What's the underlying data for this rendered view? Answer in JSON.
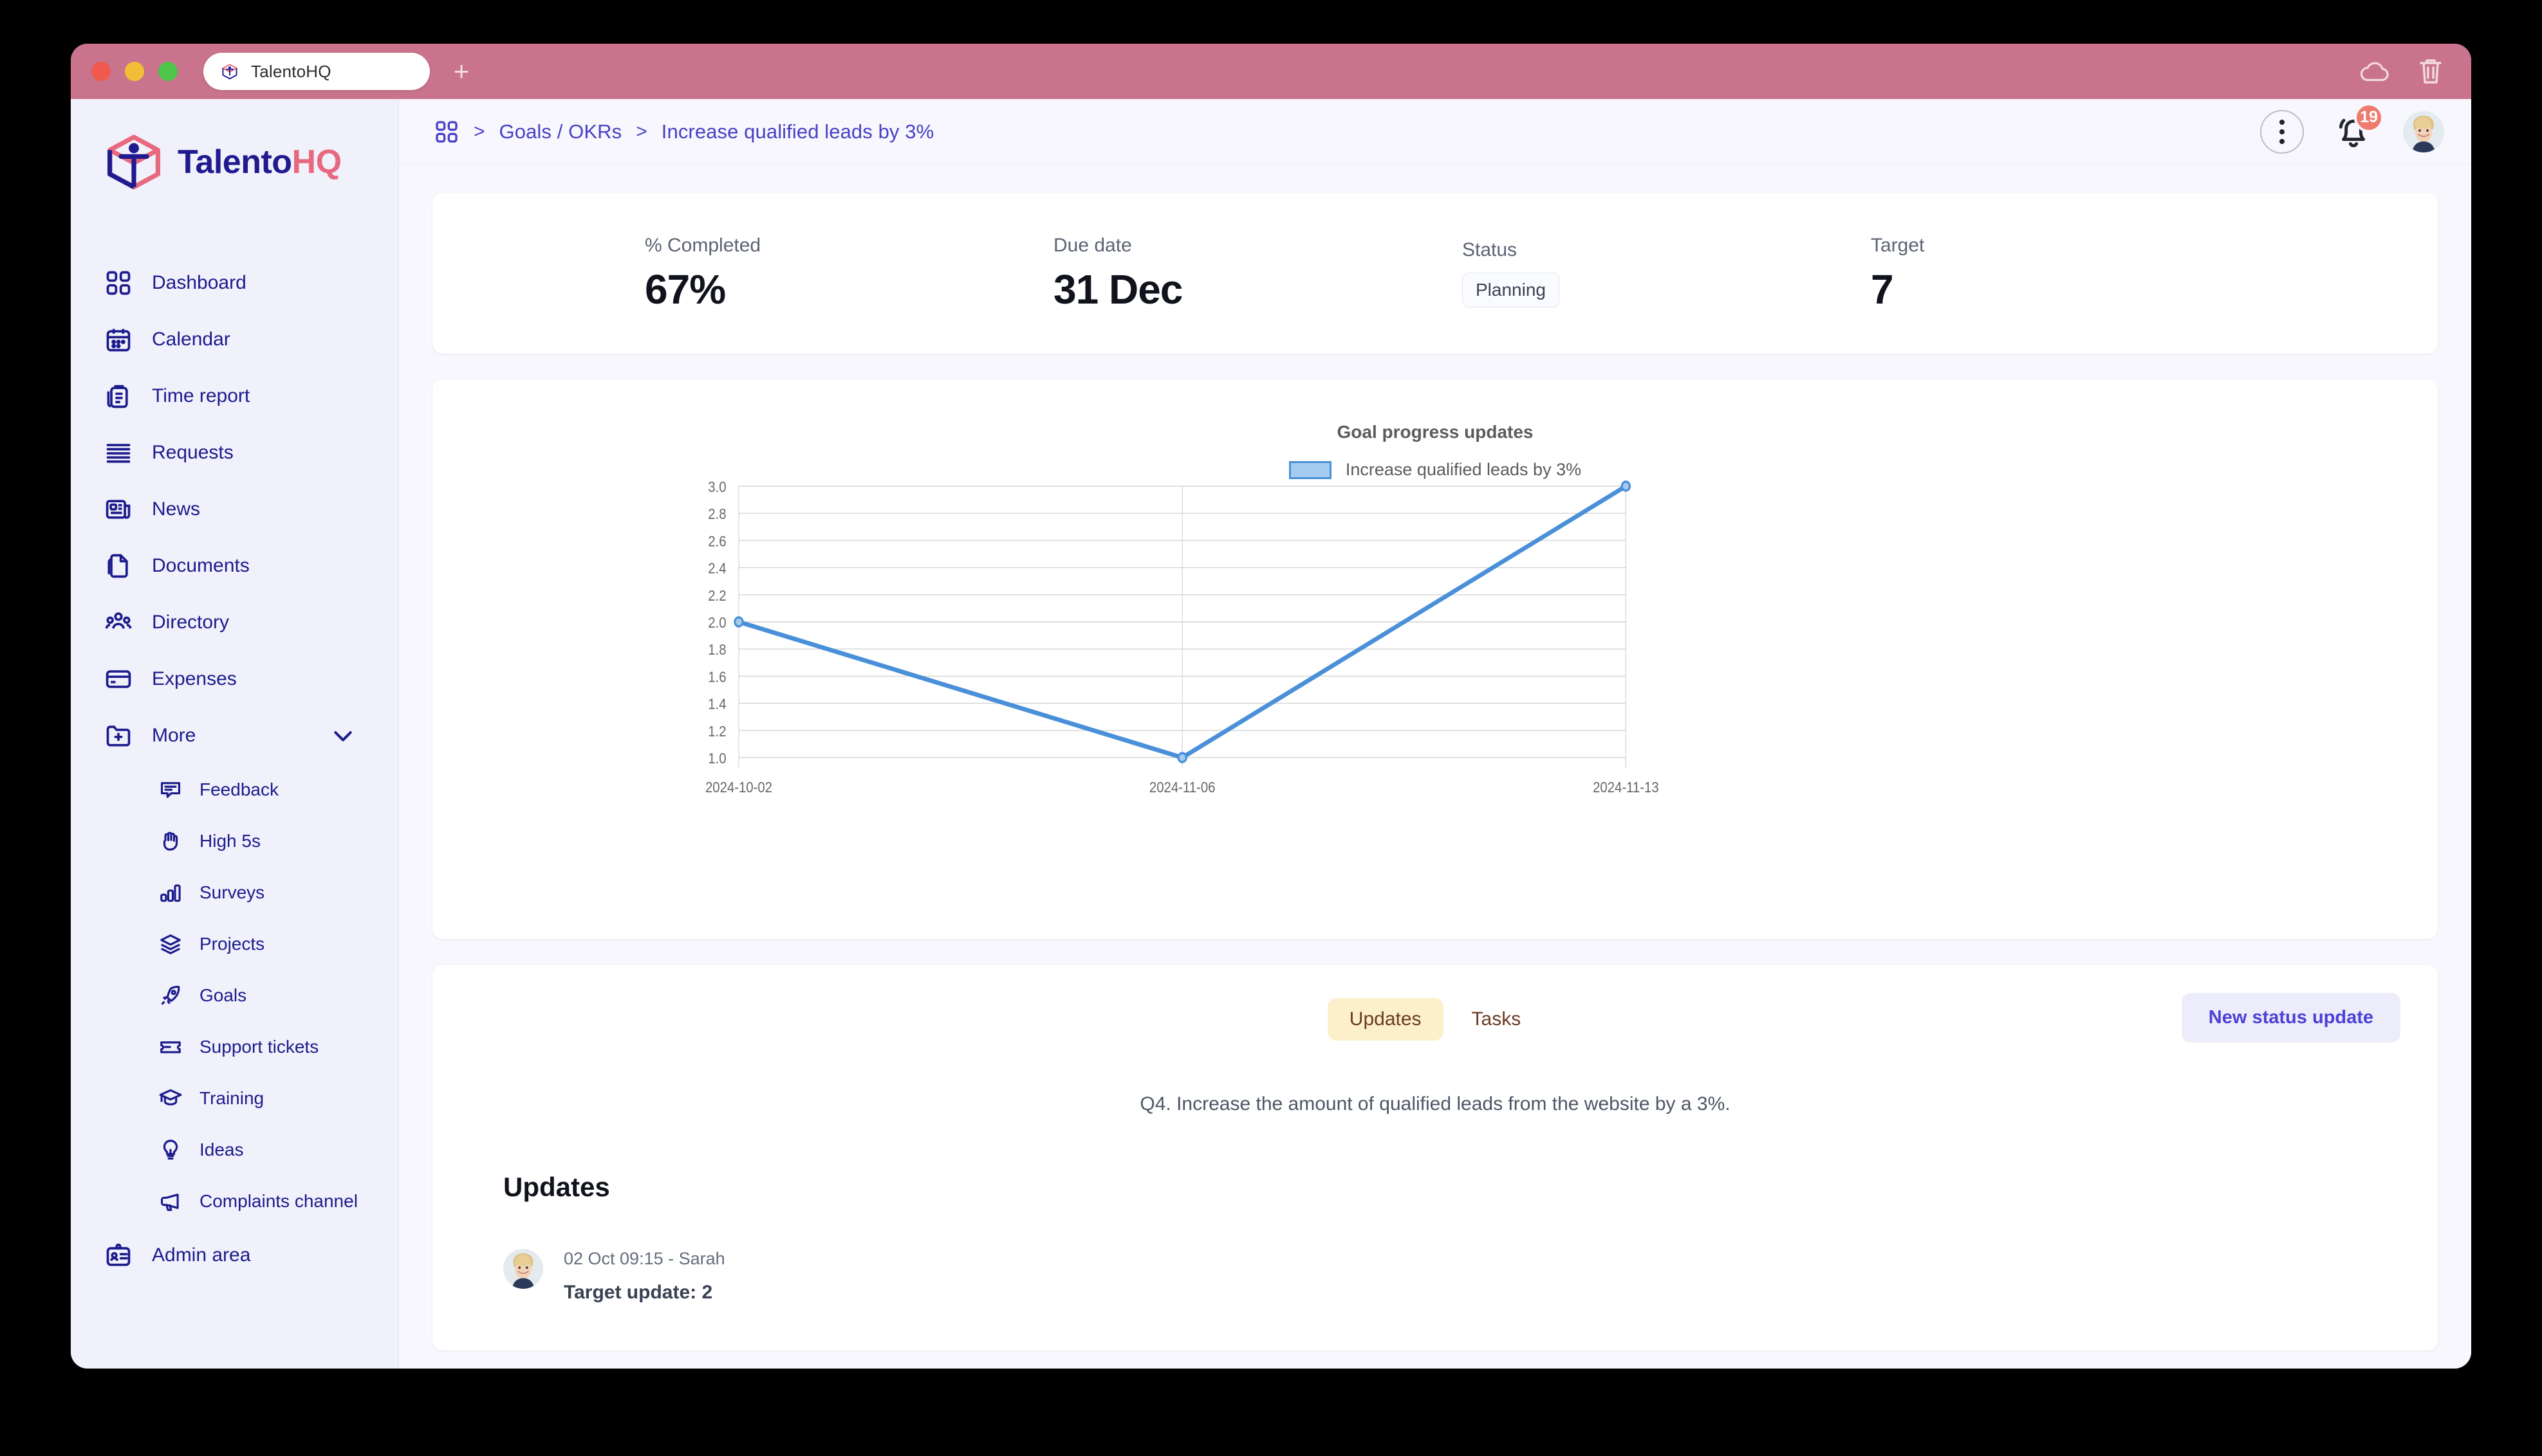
{
  "browser": {
    "tab_title": "TalentoHQ",
    "favicon_icon": "talentohq-cube-icon",
    "new_tab_icon": "plus-icon",
    "window_controls": [
      "close",
      "minimize",
      "maximize"
    ],
    "right_icons": [
      "cloud-icon",
      "trash-icon"
    ]
  },
  "sidebar": {
    "brand": {
      "name_primary": "Talento",
      "name_secondary": "HQ",
      "logo_icon": "talentohq-cube-logo"
    },
    "items": [
      {
        "label": "Dashboard",
        "icon": "grid-icon"
      },
      {
        "label": "Calendar",
        "icon": "calendar-icon"
      },
      {
        "label": "Time report",
        "icon": "clipboard-list-icon"
      },
      {
        "label": "Requests",
        "icon": "stacked-lines-icon"
      },
      {
        "label": "News",
        "icon": "newspaper-icon"
      },
      {
        "label": "Documents",
        "icon": "documents-icon"
      },
      {
        "label": "Directory",
        "icon": "people-group-icon"
      },
      {
        "label": "Expenses",
        "icon": "credit-card-icon"
      },
      {
        "label": "More",
        "icon": "folder-plus-icon",
        "expandable": true,
        "chevron_icon": "chevron-down-icon"
      }
    ],
    "sub_items": [
      {
        "label": "Feedback",
        "icon": "speech-bubble-icon"
      },
      {
        "label": "High 5s",
        "icon": "hand-icon"
      },
      {
        "label": "Surveys",
        "icon": "bar-chart-icon"
      },
      {
        "label": "Projects",
        "icon": "layers-icon"
      },
      {
        "label": "Goals",
        "icon": "rocket-icon"
      },
      {
        "label": "Support tickets",
        "icon": "ticket-icon"
      },
      {
        "label": "Training",
        "icon": "graduation-cap-icon"
      },
      {
        "label": "Ideas",
        "icon": "lightbulb-icon"
      },
      {
        "label": "Complaints channel",
        "icon": "megaphone-icon"
      }
    ],
    "footer_items": [
      {
        "label": "Admin area",
        "icon": "id-badge-icon"
      }
    ]
  },
  "topbar": {
    "home_icon": "grid-icon",
    "separator": ">",
    "breadcrumb": [
      "Goals / OKRs",
      "Increase qualified leads by 3%"
    ],
    "kebab_icon": "kebab-menu-icon",
    "bell_icon": "bell-icon",
    "notification_count": "19",
    "avatar_icon": "user-avatar"
  },
  "stats": [
    {
      "label": "% Completed",
      "value": "67%",
      "type": "text"
    },
    {
      "label": "Due date",
      "value": "31 Dec",
      "type": "text"
    },
    {
      "label": "Status",
      "value": "Planning",
      "type": "pill"
    },
    {
      "label": "Target",
      "value": "7",
      "type": "text"
    }
  ],
  "chart_data": {
    "type": "line",
    "title": "Goal progress updates",
    "xlabel": "",
    "ylabel": "",
    "x": [
      "2024-10-02",
      "2024-11-06",
      "2024-11-13"
    ],
    "series": [
      {
        "name": "Increase qualified leads by 3%",
        "values": [
          2.0,
          1.0,
          3.0
        ],
        "color": "#4a90d9",
        "fill": "#a5cbef"
      }
    ],
    "ylim": [
      1.0,
      3.0
    ],
    "yticks": [
      "1.0",
      "1.2",
      "1.4",
      "1.6",
      "1.8",
      "2.0",
      "2.2",
      "2.4",
      "2.6",
      "2.8",
      "3.0"
    ],
    "xticks": [
      "2024-10-02",
      "2024-11-06",
      "2024-11-13"
    ],
    "grid": true,
    "legend_position": "top"
  },
  "updates_panel": {
    "tabs": [
      {
        "label": "Updates",
        "active": true
      },
      {
        "label": "Tasks",
        "active": false
      }
    ],
    "action_button": "New status update",
    "goal_description": "Q4. Increase the amount of qualified leads from the website by a 3%.",
    "section_heading": "Updates",
    "entries": [
      {
        "meta": "02 Oct 09:15 - Sarah",
        "text": "Target update: 2",
        "avatar_icon": "user-avatar"
      }
    ]
  },
  "colors": {
    "titlebar": "#c9738d",
    "sidebar_bg": "#f0f1fb",
    "brand_primary": "#1f1b8f",
    "brand_accent": "#e8697f",
    "breadcrumb": "#4840c4",
    "accent_button": "#4b42d6",
    "tab_active_bg": "#fbf0c9",
    "badge": "#ef7b6f",
    "line": "#4a90d9"
  }
}
